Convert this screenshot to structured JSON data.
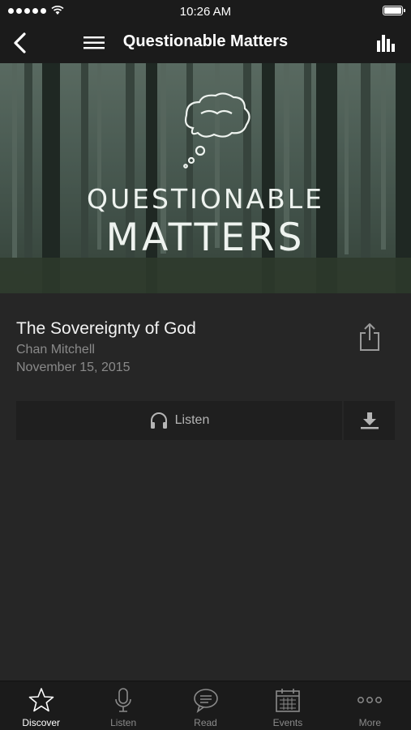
{
  "status_bar": {
    "time": "10:26 AM"
  },
  "nav": {
    "title": "Questionable Matters"
  },
  "hero": {
    "line1": "QUESTIONABLE",
    "line2": "MATTERS"
  },
  "sermon": {
    "title": "The Sovereignty of God",
    "speaker": "Chan Mitchell",
    "date": "November 15, 2015"
  },
  "actions": {
    "listen_label": "Listen"
  },
  "tabs": [
    {
      "label": "Discover",
      "icon": "star-icon",
      "active": true
    },
    {
      "label": "Listen",
      "icon": "microphone-icon",
      "active": false
    },
    {
      "label": "Read",
      "icon": "speech-bubble-icon",
      "active": false
    },
    {
      "label": "Events",
      "icon": "calendar-icon",
      "active": false
    },
    {
      "label": "More",
      "icon": "more-dots-icon",
      "active": false
    }
  ],
  "colors": {
    "background": "#262626",
    "bar": "#1b1b1b",
    "button": "#1f1f1f",
    "muted_text": "#8a8a8a"
  }
}
